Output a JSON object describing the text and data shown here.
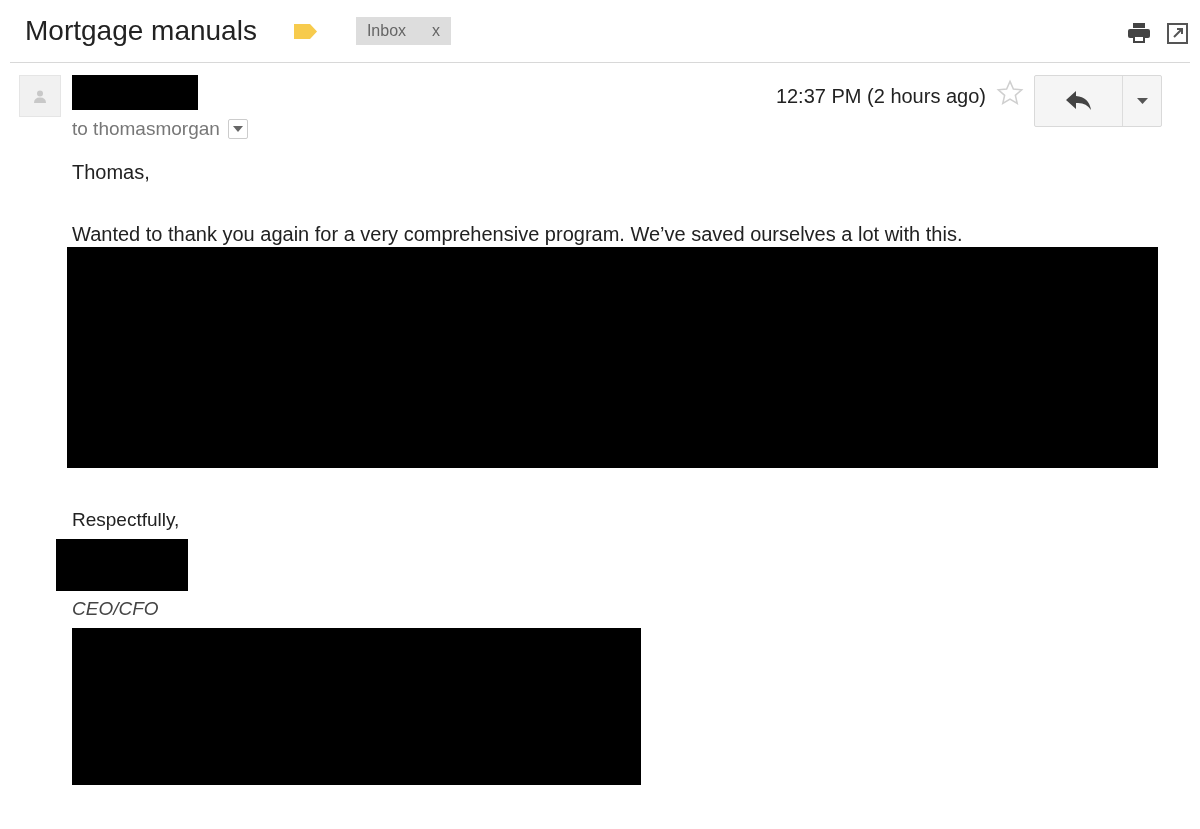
{
  "subject": "Mortgage manuals",
  "label_tag": {
    "text": "Inbox",
    "remove": "x"
  },
  "message": {
    "recipient": "to thomasmorgan",
    "time": "12:37 PM (2 hours ago)",
    "starred": false,
    "body": [
      "Thomas,",
      "Wanted to thank you again for a very comprehensive program. We’ve saved ourselves a lot with this."
    ],
    "closing": "Respectfully,",
    "signature_title": "CEO/CFO"
  }
}
